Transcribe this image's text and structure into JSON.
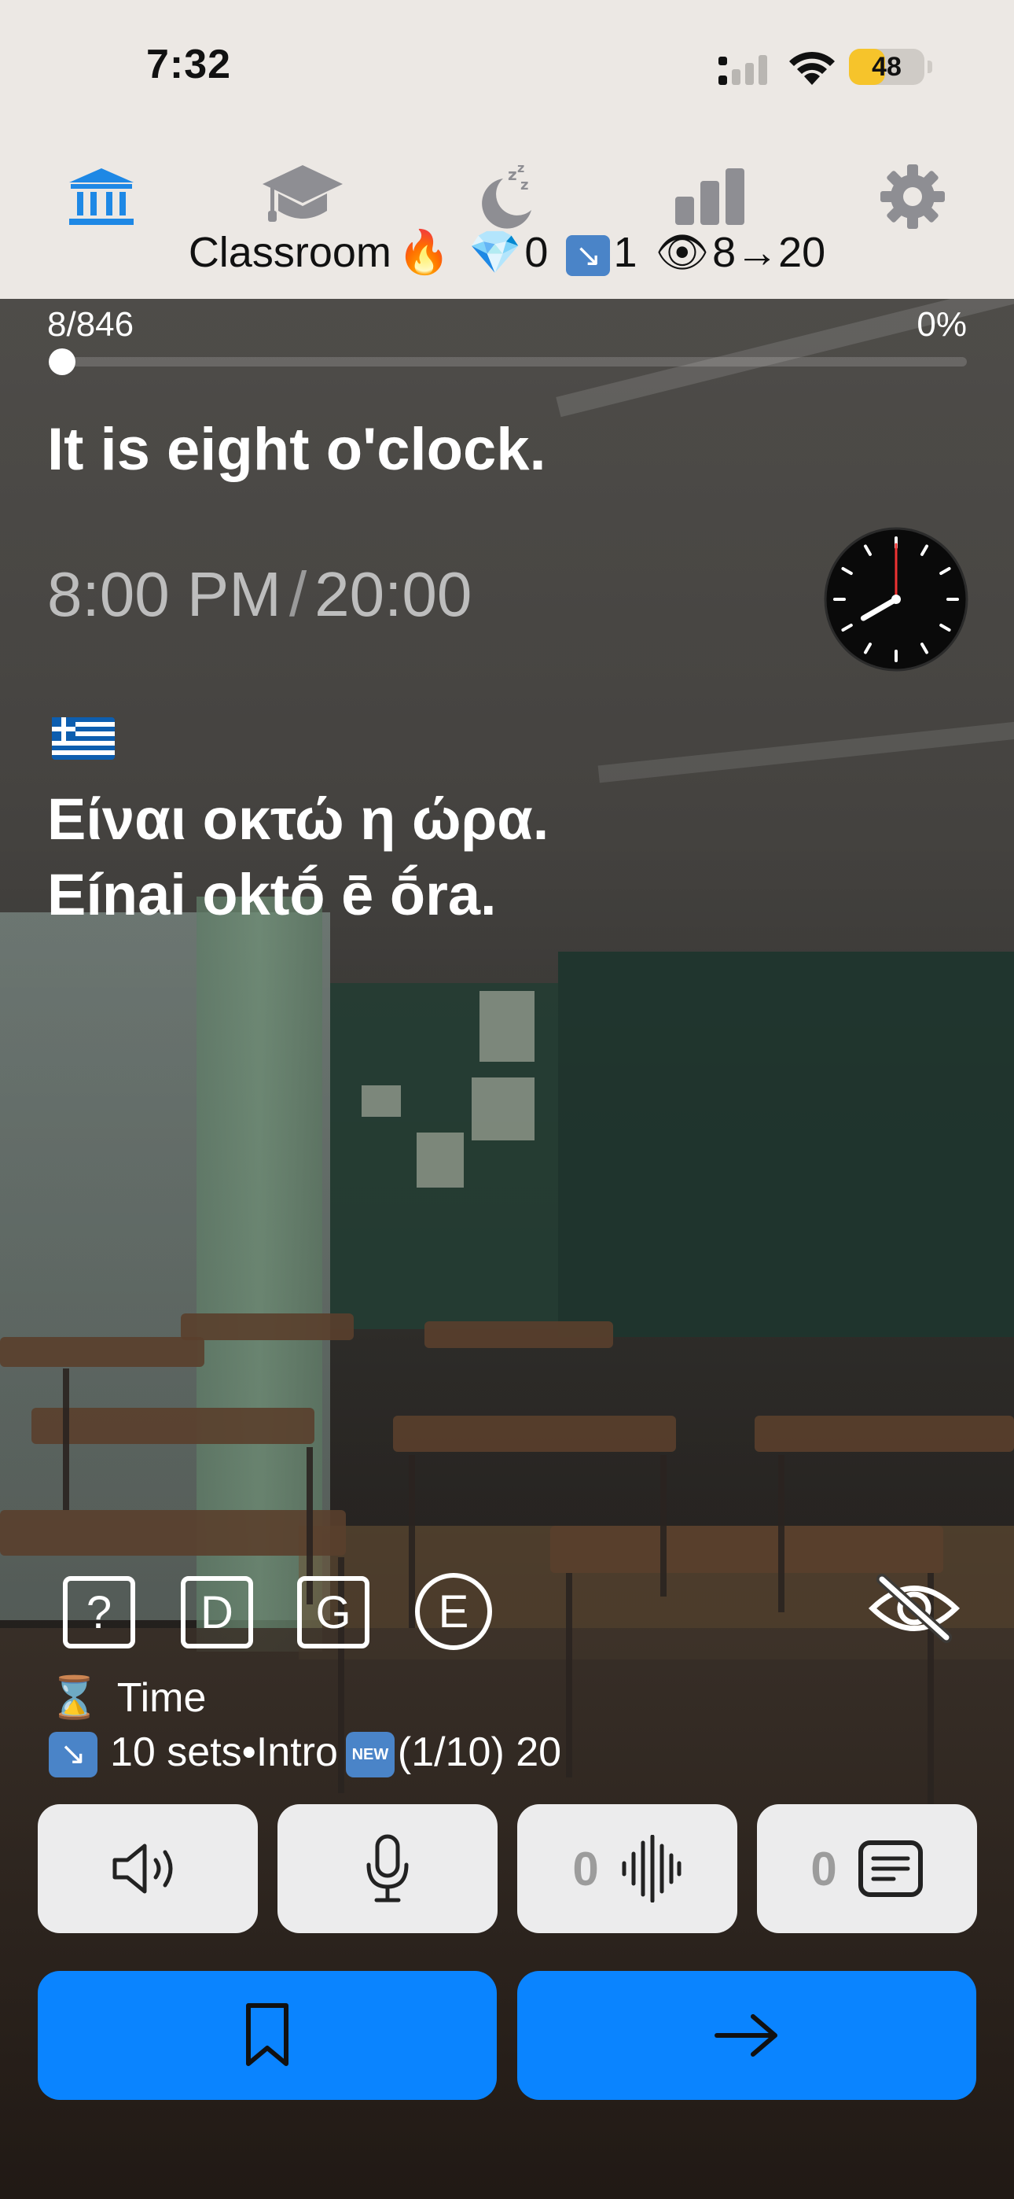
{
  "status_bar": {
    "time": "7:32",
    "battery_level": "48",
    "battery_fraction": 0.48
  },
  "nav": {
    "icons": [
      "bank-icon",
      "graduation-cap-icon",
      "sleep-icon",
      "bar-chart-icon",
      "gear-icon"
    ],
    "title": "Classroom",
    "fire": "🔥",
    "gem": "💎",
    "gem_count": "0",
    "review_icon": "↘",
    "review_count": "1",
    "eye": "👁",
    "seen_progress": "8→20"
  },
  "progress": {
    "count": "8/846",
    "percent": "0%",
    "fraction": 0.0095
  },
  "card": {
    "english": "It is eight o'clock.",
    "time_12h": "8:00 PM",
    "time_separator": "/",
    "time_24h": "20:00",
    "clock_hour": 8,
    "clock_minute": 0,
    "greek": "Είναι οκτώ η ώρα.",
    "transliteration": "Eínai oktṓ ē ṓra."
  },
  "tools": {
    "question": "?",
    "d": "D",
    "g": "G",
    "e": "E"
  },
  "info": {
    "hourglass": "⌛",
    "topic": "Time",
    "sets_icon": "↘",
    "sets_text": "10 sets•Intro",
    "new_badge": "NEW",
    "new_text": "(1/10) 20"
  },
  "actions": {
    "waveform_count": "0",
    "text_count": "0"
  },
  "colors": {
    "accent": "#0a84ff",
    "battery": "#f6c42b",
    "nav_active": "#1e88e5",
    "nav_inactive": "#8e8e93"
  }
}
